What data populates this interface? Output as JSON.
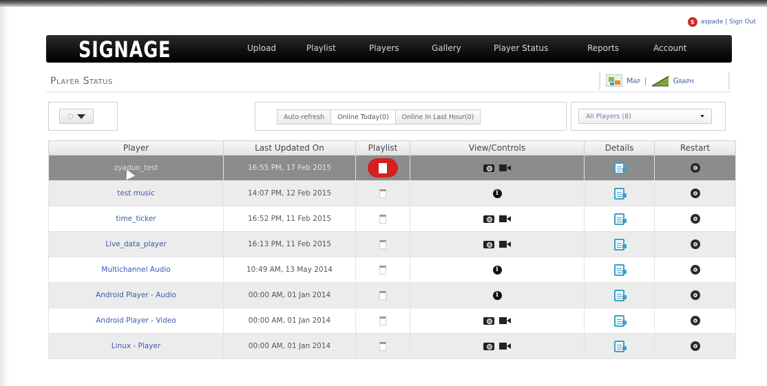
{
  "user": {
    "avatar_letter": "S",
    "links": "aspade | Sign Out"
  },
  "header": {
    "brand": "SIGNAGE",
    "nav": [
      "Upload",
      "Playlist",
      "Players",
      "Gallery",
      "Player Status",
      "Reports",
      "Account"
    ]
  },
  "page": {
    "title": "Player Status",
    "map_label": "Map",
    "separator": "|",
    "graph_label": "Graph"
  },
  "toolbar": {
    "split_button_glyph": "○",
    "tabs": [
      "Auto-refresh",
      "Online Today(0)",
      "Online In Last Hour(0)"
    ],
    "active_tab": "Online Today(0)",
    "player_filter": "All Players (8)"
  },
  "table": {
    "columns": [
      "Player",
      "Last Updated On",
      "Playlist",
      "View/Controls",
      "Details",
      "Restart"
    ],
    "rows": [
      {
        "player": "zyaduo_test",
        "updated": "16:55 PM, 17 Feb 2015",
        "controls": "camera-video",
        "selected": true
      },
      {
        "player": "test music",
        "updated": "14:07 PM, 12 Feb 2015",
        "controls": "info"
      },
      {
        "player": "time_ticker",
        "updated": "16:52 PM, 11 Feb 2015",
        "controls": "camera-video"
      },
      {
        "player": "Live_data_player",
        "updated": "16:13 PM, 11 Feb 2015",
        "controls": "camera-video"
      },
      {
        "player": "Multichannel Audio",
        "updated": "10:49 AM, 13 May 2014",
        "controls": "info"
      },
      {
        "player": "Android Player - Audio",
        "updated": "00:00 AM, 01 Jan 2014",
        "controls": "info"
      },
      {
        "player": "Android Player - Video",
        "updated": "00:00 AM, 01 Jan 2014",
        "controls": "camera-video"
      },
      {
        "player": "Linux - Player",
        "updated": "00:00 AM, 01 Jan 2014",
        "controls": "camera-video"
      }
    ]
  },
  "colors": {
    "link": "#3b5aa8",
    "active_playlist": "#d42020",
    "details_icon": "#3aa0c8",
    "navbar": "#111111",
    "selected_row": "#8c8c8c"
  }
}
